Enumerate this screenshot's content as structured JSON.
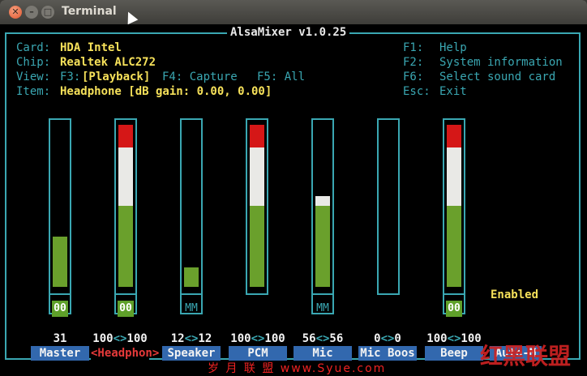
{
  "window": {
    "title": "Terminal"
  },
  "mixer": {
    "title": "AlsaMixer v1.0.25",
    "card_label": "Card:",
    "card_value": "HDA Intel",
    "chip_label": "Chip:",
    "chip_value": "Realtek ALC272",
    "view_label": "View:",
    "view_f3": "F3:",
    "view_playback": "[Playback]",
    "view_f4": "F4: Capture",
    "view_f5": "F5: All",
    "item_label": "Item:",
    "item_value": "Headphone [dB gain: 0.00, 0.00]",
    "keys": [
      {
        "key": "F1:",
        "desc": "Help"
      },
      {
        "key": "F2:",
        "desc": "System information"
      },
      {
        "key": "F6:",
        "desc": "Select sound card"
      },
      {
        "key": "Esc:",
        "desc": "Exit"
      }
    ],
    "enabled_text": "Enabled",
    "channels": [
      {
        "name": "Master",
        "value_l": "31",
        "sep": "",
        "value_r": "",
        "level": 0.31,
        "mute": "00",
        "mute_on": true
      },
      {
        "name": "<Headphon>",
        "value_l": "100",
        "sep": "<>",
        "value_r": "100",
        "level": 1.0,
        "mute": "00",
        "mute_on": true
      },
      {
        "name": "Speaker",
        "value_l": "12",
        "sep": "<>",
        "value_r": "12",
        "level": 0.12,
        "mute": "MM",
        "mute_on": false
      },
      {
        "name": "PCM",
        "value_l": "100",
        "sep": "<>",
        "value_r": "100",
        "level": 1.0,
        "mute": "",
        "mute_on": null
      },
      {
        "name": "Mic",
        "value_l": "56",
        "sep": "<>",
        "value_r": "56",
        "level": 0.56,
        "mute": "MM",
        "mute_on": false
      },
      {
        "name": "Mic Boos",
        "value_l": "0",
        "sep": "<>",
        "value_r": "0",
        "level": 0.0,
        "mute": "",
        "mute_on": null
      },
      {
        "name": "Beep",
        "value_l": "100",
        "sep": "<>",
        "value_r": "100",
        "level": 1.0,
        "mute": "00",
        "mute_on": true
      }
    ],
    "partial_label": "Auto-M"
  },
  "watermark": {
    "text": "岁 月 联 盟   www.Syue.com",
    "logo": "红黑联盟"
  }
}
